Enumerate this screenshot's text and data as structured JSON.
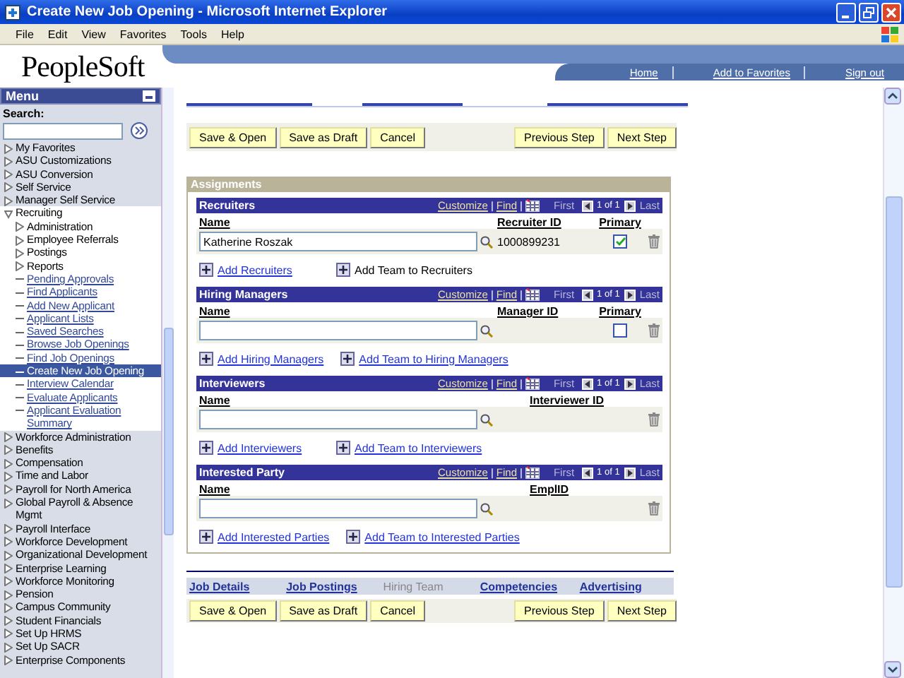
{
  "window": {
    "title": "Create New Job Opening - Microsoft Internet Explorer"
  },
  "menu_bar": [
    "File",
    "Edit",
    "View",
    "Favorites",
    "Tools",
    "Help"
  ],
  "header": {
    "logo": "PeopleSoft",
    "links": [
      "Home",
      "Add to Favorites",
      "Sign out"
    ]
  },
  "sidebar": {
    "title": "Menu",
    "search_label": "Search:",
    "items": [
      {
        "label": "My Favorites",
        "expanded": false
      },
      {
        "label": "ASU Customizations",
        "expanded": false
      },
      {
        "label": "ASU Conversion",
        "expanded": false
      },
      {
        "label": "Self Service",
        "expanded": false
      },
      {
        "label": "Manager Self Service",
        "expanded": false
      },
      {
        "label": "Recruiting",
        "expanded": true,
        "children": [
          {
            "label": "Administration",
            "kind": "folder",
            "selected": false
          },
          {
            "label": "Employee Referrals",
            "kind": "folder",
            "selected": false
          },
          {
            "label": "Postings",
            "kind": "folder",
            "selected": false
          },
          {
            "label": "Reports",
            "kind": "folder",
            "selected": false
          },
          {
            "label": "Pending Approvals",
            "kind": "link",
            "selected": false
          },
          {
            "label": "Find Applicants",
            "kind": "link",
            "selected": false
          },
          {
            "label": "Add New Applicant",
            "kind": "link",
            "selected": false
          },
          {
            "label": "Applicant Lists",
            "kind": "link",
            "selected": false
          },
          {
            "label": "Saved Searches",
            "kind": "link",
            "selected": false
          },
          {
            "label": "Browse Job Openings",
            "kind": "link",
            "selected": false
          },
          {
            "label": "Find Job Openings",
            "kind": "link",
            "selected": false
          },
          {
            "label": "Create New Job Opening",
            "kind": "link",
            "selected": true
          },
          {
            "label": "Interview Calendar",
            "kind": "link",
            "selected": false
          },
          {
            "label": "Evaluate Applicants",
            "kind": "link",
            "selected": false
          },
          {
            "label": "Applicant Evaluation Summary",
            "kind": "link",
            "selected": false
          }
        ]
      },
      {
        "label": "Workforce Administration",
        "expanded": false
      },
      {
        "label": "Benefits",
        "expanded": false
      },
      {
        "label": "Compensation",
        "expanded": false
      },
      {
        "label": "Time and Labor",
        "expanded": false
      },
      {
        "label": "Payroll for North America",
        "expanded": false
      },
      {
        "label": "Global Payroll & Absence Mgmt",
        "expanded": false
      },
      {
        "label": "Payroll Interface",
        "expanded": false
      },
      {
        "label": "Workforce Development",
        "expanded": false
      },
      {
        "label": "Organizational Development",
        "expanded": false
      },
      {
        "label": "Enterprise Learning",
        "expanded": false
      },
      {
        "label": "Workforce Monitoring",
        "expanded": false
      },
      {
        "label": "Pension",
        "expanded": false
      },
      {
        "label": "Campus Community",
        "expanded": false
      },
      {
        "label": "Student Financials",
        "expanded": false
      },
      {
        "label": "Set Up HRMS",
        "expanded": false
      },
      {
        "label": "Set Up SACR",
        "expanded": false
      },
      {
        "label": "Enterprise Components",
        "expanded": false
      }
    ]
  },
  "toolbar": {
    "left": [
      "Save & Open",
      "Save as Draft",
      "Cancel"
    ],
    "right": [
      "Previous Step",
      "Next Step"
    ]
  },
  "assignments": {
    "title": "Assignments",
    "grids": [
      {
        "title": "Recruiters",
        "customize": "Customize",
        "separator": "|",
        "find": "Find",
        "first": "First",
        "count": "1 of 1",
        "last": "Last",
        "columns": [
          "Name",
          "Recruiter ID",
          "Primary"
        ],
        "rows": [
          {
            "name": "Katherine Roszak",
            "id": "1000899231",
            "primary": true
          }
        ],
        "actions": [
          {
            "label": "Add Recruiters",
            "link": true
          },
          {
            "label": "Add Team to Recruiters",
            "link": false
          }
        ]
      },
      {
        "title": "Hiring Managers",
        "customize": "Customize",
        "separator": "|",
        "find": "Find",
        "first": "First",
        "count": "1 of 1",
        "last": "Last",
        "columns": [
          "Name",
          "Manager ID",
          "Primary"
        ],
        "rows": [
          {
            "primary": false
          }
        ],
        "actions": [
          {
            "label": "Add Hiring Managers",
            "link": true
          },
          {
            "label": "Add Team to Hiring Managers",
            "link": true
          }
        ]
      },
      {
        "title": "Interviewers",
        "customize": "Customize",
        "separator": "|",
        "find": "Find",
        "first": "First",
        "count": "1 of 1",
        "last": "Last",
        "columns": [
          "Name",
          "Interviewer ID"
        ],
        "rows": [
          {}
        ],
        "actions": [
          {
            "label": "Add Interviewers",
            "link": true
          },
          {
            "label": "Add Team to Interviewers",
            "link": true
          }
        ]
      },
      {
        "title": "Interested Party",
        "customize": "Customize",
        "separator": "|",
        "find": "Find",
        "first": "First",
        "count": "1 of 1",
        "last": "Last",
        "columns": [
          "Name",
          "EmplID"
        ],
        "rows": [
          {}
        ],
        "actions": [
          {
            "label": "Add Interested Parties",
            "link": true
          },
          {
            "label": "Add Team to Interested Parties",
            "link": true
          }
        ]
      }
    ]
  },
  "step_tabs": [
    {
      "label": "Job Details",
      "selected": false
    },
    {
      "label": "Job Postings",
      "selected": false
    },
    {
      "label": "Hiring Team",
      "selected": true
    },
    {
      "label": "Competencies",
      "selected": false
    },
    {
      "label": "Advertising",
      "selected": false
    }
  ],
  "bottom_toolbar": {
    "left": [
      "Save & Open",
      "Save as Draft",
      "Cancel"
    ],
    "right": [
      "Previous Step",
      "Next Step"
    ]
  }
}
